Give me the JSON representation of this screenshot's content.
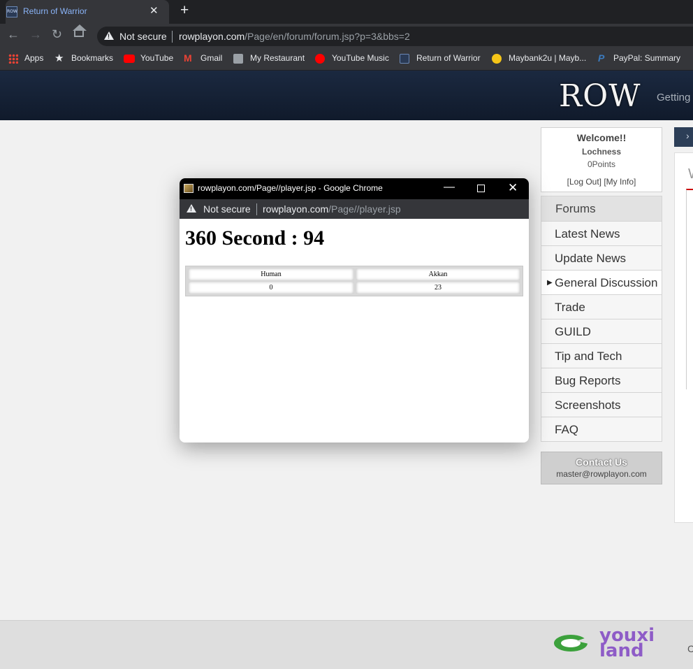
{
  "browser": {
    "tab_title": "Return of Warrior",
    "tab_favicon": "ROW",
    "new_tab": "+",
    "close_tab": "✕",
    "security_label": "Not secure",
    "url_host": "rowplayon.com",
    "url_path": "/Page/en/forum/forum.jsp?p=3&bbs=2",
    "bookmarks": [
      {
        "label": "Apps",
        "icon": "apps-grid-icon"
      },
      {
        "label": "Bookmarks",
        "icon": "star-icon"
      },
      {
        "label": "YouTube",
        "icon": "youtube-icon"
      },
      {
        "label": "Gmail",
        "icon": "gmail-icon"
      },
      {
        "label": "My Restaurant",
        "icon": "store-icon"
      },
      {
        "label": "YouTube Music",
        "icon": "youtube-music-icon"
      },
      {
        "label": "Return of Warrior",
        "icon": "row-icon"
      },
      {
        "label": "Maybank2u | Mayb...",
        "icon": "maybank-icon"
      },
      {
        "label": "PayPal: Summary",
        "icon": "paypal-icon"
      }
    ]
  },
  "site": {
    "logo": "ROW",
    "nav_partial": "Getting"
  },
  "sidebar": {
    "welcome": "Welcome!!",
    "username": "Lochness",
    "points": "0Points",
    "links": "[Log Out] [My Info]",
    "menu_header": "Forums",
    "menu_items": [
      {
        "label": "Latest News"
      },
      {
        "label": "Update News"
      },
      {
        "label": "General Discussion",
        "active": true
      },
      {
        "label": "Trade"
      },
      {
        "label": "GUILD"
      },
      {
        "label": "Tip and Tech"
      },
      {
        "label": "Bug Reports"
      },
      {
        "label": "Screenshots"
      },
      {
        "label": "FAQ"
      }
    ],
    "contact_title": "Contact Us",
    "contact_email": "master@rowplayon.com"
  },
  "right_panel": {
    "heading_partial": "W"
  },
  "footer": {
    "partner_logo_text": "youxi land",
    "partial_text": "C"
  },
  "popup": {
    "window_title": "rowplayon.com/Page//player.jsp - Google Chrome",
    "security_label": "Not secure",
    "url_host": "rowplayon.com",
    "url_path": "/Page//player.jsp",
    "heading": "360 Second : 94",
    "table": {
      "headers": [
        "Human",
        "Akkan"
      ],
      "rows": [
        [
          "0",
          "23"
        ]
      ]
    }
  },
  "colors": {
    "tab_active_text": "#8ab4f8",
    "header_bg": "#1b2940",
    "accent_red": "#cc0000"
  }
}
